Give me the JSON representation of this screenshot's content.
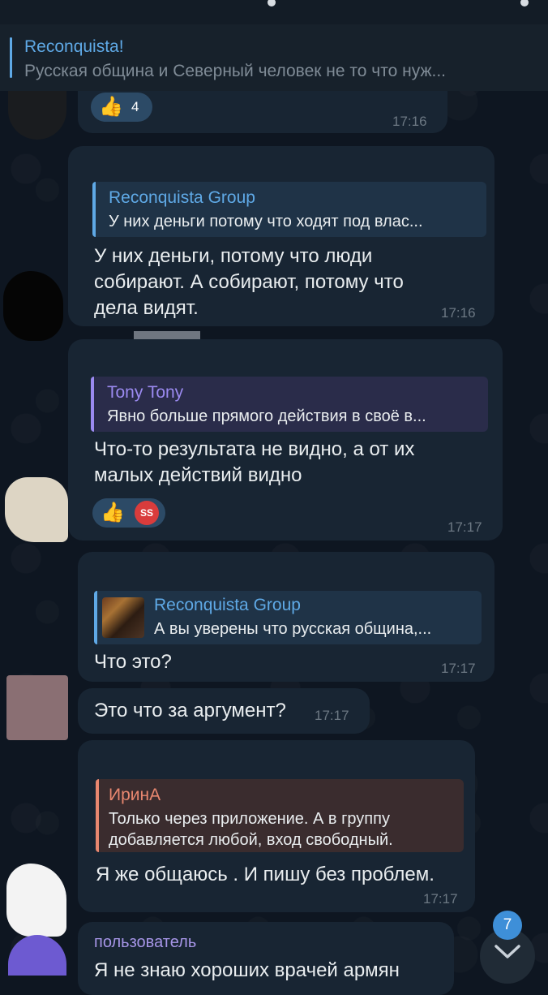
{
  "pinned": {
    "title": "Reconquista!",
    "text": "Русская община и Северный человек не то что нуж..."
  },
  "messages": [
    {
      "reaction_count": "4",
      "time": "17:16"
    },
    {
      "reply_name": "Reconquista Group",
      "reply_text": "У них деньги потому что ходят под влас...",
      "lines": [
        "У них деньги, потому что люди",
        "собирают. А собирают, потому что",
        "дела видят."
      ],
      "time": "17:16"
    },
    {
      "reply_name": "Tony Tony",
      "reply_text": "Явно больше прямого действия в своё в...",
      "lines": [
        "Что-то результата не видно, а от их",
        "малых действий видно"
      ],
      "reaction_badge": "SS",
      "time": "17:17"
    },
    {
      "reply_name": "Reconquista Group",
      "reply_text": "А вы уверены что русская община,...",
      "lines": [
        "Что это?"
      ],
      "time": "17:17"
    },
    {
      "lines": [
        "Это что за аргумент?"
      ],
      "time": "17:17"
    },
    {
      "reply_name": "ИринА",
      "reply_text_lines": [
        "Только через приложение. А в группу",
        "добавляется любой, вход свободный."
      ],
      "lines": [
        "Я же общаюсь . И пишу без проблем."
      ],
      "time": "17:17"
    },
    {
      "sender": "пользователь",
      "lines": [
        "Я не знаю хороших врачей армян"
      ]
    }
  ],
  "unread_badge": "7",
  "colors": {
    "background": "#0e1621",
    "bubble": "#182533",
    "reply_blue": "#5fa9e6",
    "reply_purple": "#9b8af0",
    "reply_red": "#e8876f",
    "sender_purple": "#a695e7"
  },
  "icons": {
    "thumbs_up": "👍",
    "chevron": "chevron-down-icon"
  }
}
